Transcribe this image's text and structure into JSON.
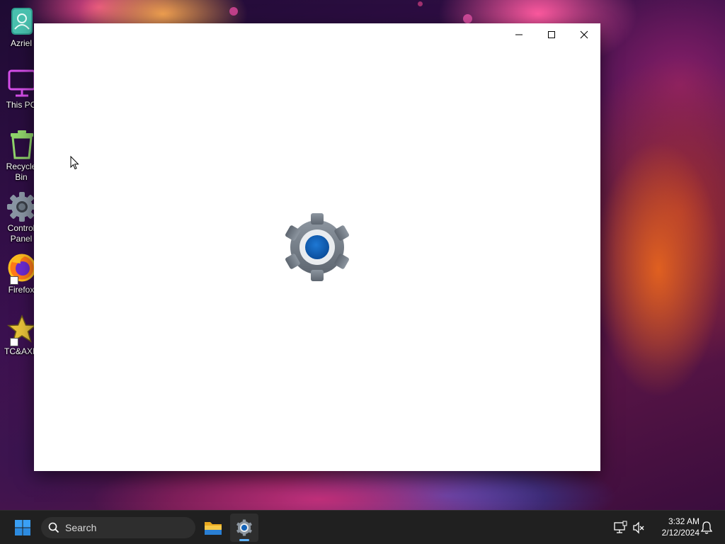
{
  "desktop": {
    "icons": [
      {
        "label": "Azriel",
        "icon": "user-folder-icon"
      },
      {
        "label": "This PC",
        "icon": "monitor-icon"
      },
      {
        "label": "Recycle Bin",
        "icon": "recycle-bin-icon"
      },
      {
        "label": "Control Panel",
        "icon": "control-panel-icon"
      },
      {
        "label": "Firefox",
        "icon": "firefox-icon"
      },
      {
        "label": "TC&AXE",
        "icon": "star-icon"
      }
    ]
  },
  "window": {
    "app": "Settings",
    "state": "loading splash",
    "controls": {
      "minimize": "minimize-icon",
      "maximize": "maximize-icon",
      "close": "close-icon"
    }
  },
  "taskbar": {
    "search": {
      "placeholder": "Search"
    },
    "pinned": [
      {
        "name": "File Explorer",
        "icon": "folder-icon",
        "active": false
      },
      {
        "name": "Settings",
        "icon": "gear-icon",
        "active": true
      }
    ],
    "clock": {
      "time": "3:32 AM",
      "date": "2/12/2024"
    }
  },
  "colors": {
    "taskbar_bg": "#202020",
    "accent": "#0067c0",
    "active_indicator": "#60b4ff"
  }
}
